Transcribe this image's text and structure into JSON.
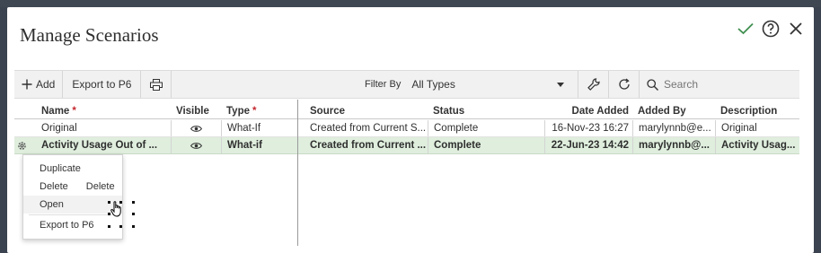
{
  "dialog": {
    "title": "Manage Scenarios",
    "icons": [
      "check-icon",
      "help-icon",
      "close-icon"
    ]
  },
  "toolbar": {
    "add_label": "Add",
    "export_label": "Export to P6",
    "filter_label": "Filter By",
    "filter_value": "All Types",
    "search_placeholder": "Search"
  },
  "grid": {
    "columns": {
      "name": "Name",
      "visible": "Visible",
      "type": "Type",
      "source": "Source",
      "status": "Status",
      "date_added": "Date Added",
      "added_by": "Added By",
      "description": "Description"
    },
    "rows": [
      {
        "name": "Original",
        "type": "What-If",
        "source": "Created from Current S...",
        "status": "Complete",
        "date_added": "16-Nov-23 16:27",
        "added_by": "marylynnb@e...",
        "description": "Original"
      },
      {
        "name": "Activity Usage Out of ...",
        "type": "What-if",
        "source": "Created from Current ...",
        "status": "Complete",
        "date_added": "22-Jun-23 14:42",
        "added_by": "marylynnb@...",
        "description": "Activity Usag..."
      }
    ]
  },
  "context_menu": {
    "duplicate": "Duplicate",
    "delete": "Delete",
    "delete_sub": "Delete",
    "open": "Open",
    "export": "Export to P6"
  },
  "colors": {
    "selected_row": "#dfeedd",
    "required_marker": "#c4262e",
    "check_icon": "#3f8f4f"
  }
}
